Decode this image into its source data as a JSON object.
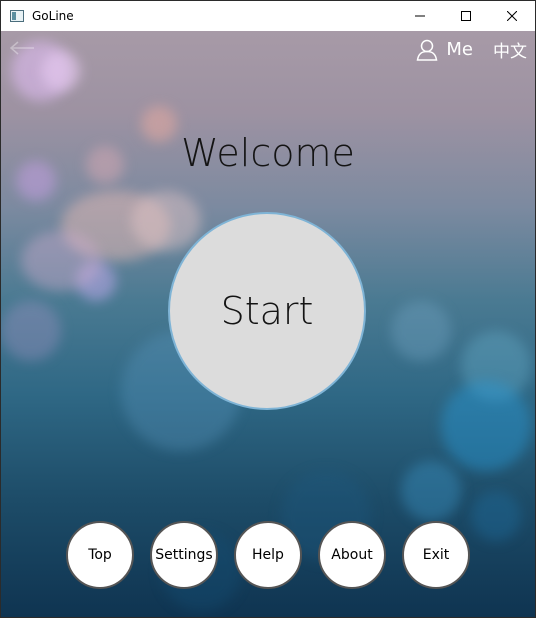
{
  "window": {
    "title": "GoLine",
    "icon": "app-window-icon"
  },
  "header": {
    "me_label": "Me",
    "language_label": "中文"
  },
  "main": {
    "welcome": "Welcome",
    "start_label": "Start"
  },
  "bottom_nav": {
    "items": [
      {
        "label": "Top"
      },
      {
        "label": "Settings"
      },
      {
        "label": "Help"
      },
      {
        "label": "About"
      },
      {
        "label": "Exit"
      }
    ]
  },
  "colors": {
    "start_fill": "#dcdcdc",
    "start_border": "#7fb4d6",
    "nav_button_fill": "#ffffff",
    "nav_button_border": "#555555"
  }
}
